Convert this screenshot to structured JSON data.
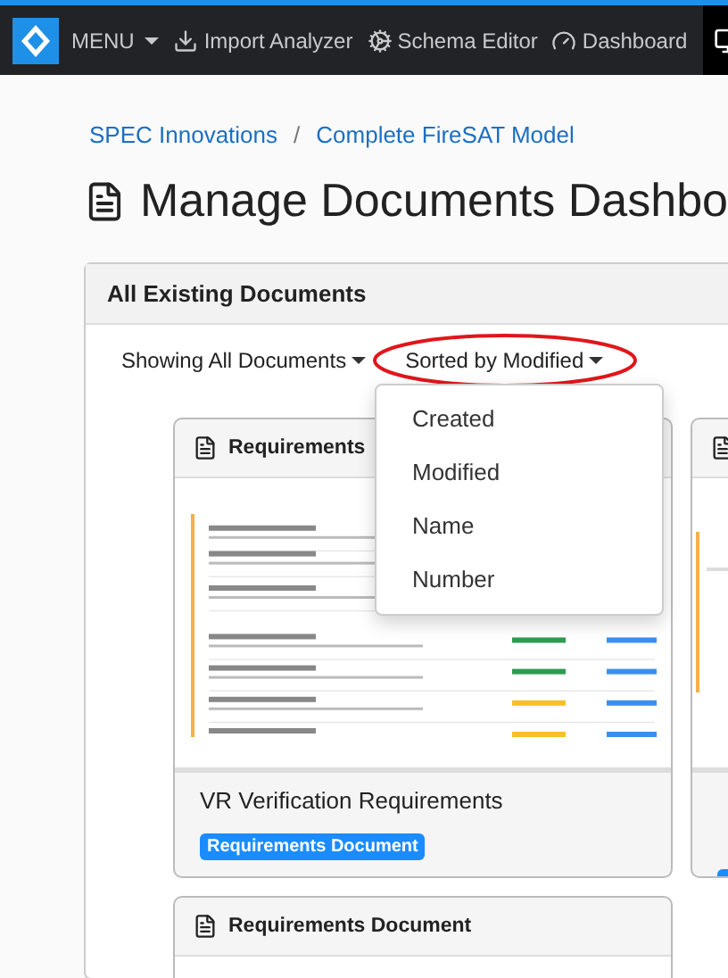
{
  "navbar": {
    "menu": "MENU",
    "items": [
      {
        "label": "Import Analyzer"
      },
      {
        "label": "Schema Editor"
      },
      {
        "label": "Dashboard"
      }
    ]
  },
  "breadcrumb": [
    "SPEC Innovations",
    "Complete FireSAT Model"
  ],
  "breadcrumb_separator": "/",
  "page_title": "Manage Documents Dashbo",
  "panel": {
    "title": "All Existing Documents",
    "filter": "Showing All Documents",
    "sort": "Sorted by Modified",
    "sort_highlighted": true,
    "sort_menu": {
      "open": true,
      "options": [
        "Created",
        "Modified",
        "Name",
        "Number"
      ]
    }
  },
  "cards": [
    {
      "header": "Requirements",
      "title_lines": [
        "VR Verification Requirements"
      ],
      "badge": "Requirements Document"
    },
    {
      "badge_visible": true
    },
    {
      "header": "Requirements Document"
    }
  ]
}
